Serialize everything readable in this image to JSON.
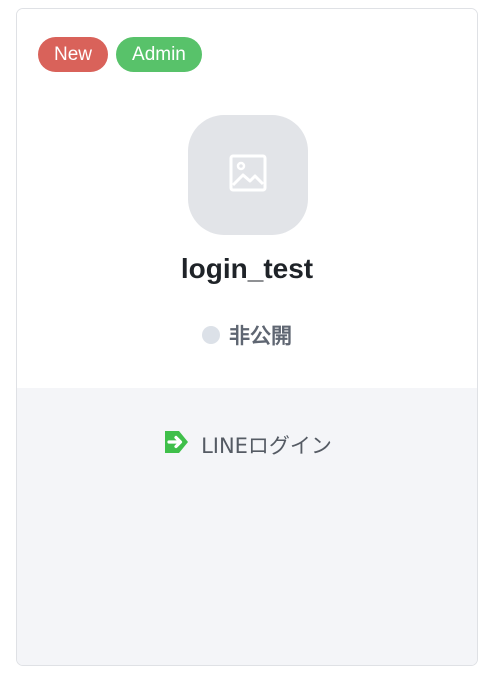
{
  "badges": {
    "new": "New",
    "admin": "Admin"
  },
  "app": {
    "name": "login_test",
    "icon": "image-placeholder-icon"
  },
  "status": {
    "label": "非公開",
    "dot_color": "#dce1e8"
  },
  "features": [
    {
      "label": "LINEログイン",
      "icon": "arrow-right-icon",
      "icon_color": "#3fbf4a"
    }
  ],
  "colors": {
    "badge_new": "#d9625a",
    "badge_admin": "#58c26a",
    "bottom_background": "#f4f5f8"
  }
}
